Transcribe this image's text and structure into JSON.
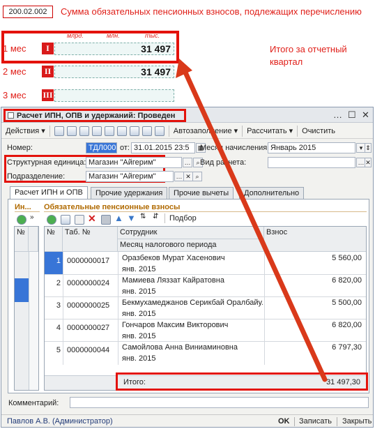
{
  "annotation": {
    "code": "200.02.002",
    "caption": "Сумма обязательных пенсионных взносов, подлежащих перечислению",
    "col_headers": [
      "млрд.",
      "млн.",
      "тыс."
    ],
    "months": [
      {
        "label": "1 мес",
        "roman": "I",
        "amount": "31 497"
      },
      {
        "label": "2 мес",
        "roman": "II",
        "amount": "31 497"
      },
      {
        "label": "3 мес",
        "roman": "III",
        "amount": ""
      }
    ],
    "total_caption": "Итого за отчетный квартал",
    "colors": {
      "accent": "#e3120b",
      "roman_bg": "#d91a1a"
    }
  },
  "window": {
    "title": "Расчет ИПН, ОПВ и удержаний: Проведен",
    "controls": [
      "…",
      "☐",
      "✕"
    ]
  },
  "toolbar": {
    "actions": "Действия",
    "autofill": "Автозаполнение",
    "calculate": "Рассчитать",
    "clear": "Очистить"
  },
  "form": {
    "number_label": "Номер:",
    "number_value": "ТДЛ000",
    "from_label": "от:",
    "date_value": "31.01.2015 23:5",
    "month_label": "Месяц начисления:",
    "month_value": "Январь 2015",
    "unit_label": "Структурная единица:",
    "unit_value": "Магазин \"Айгерим\"",
    "calc_type_label": "Вид расчета:",
    "calc_type_value": "",
    "dept_label": "Подразделение:",
    "dept_value": "Магазин \"Айгерим\""
  },
  "tabs": [
    {
      "label": "Расчет ИПН и ОПВ",
      "active": true
    },
    {
      "label": "Прочие удержания",
      "active": false
    },
    {
      "label": "Прочие вычеты",
      "active": false
    },
    {
      "label": "Дополнительно",
      "active": false
    }
  ],
  "left_section": {
    "title": "Ин..."
  },
  "section": {
    "title": "Обязательные пенсионные взносы",
    "select_button": "Подбор"
  },
  "left_grid": {
    "header": "№"
  },
  "table": {
    "headers": {
      "num": "№",
      "tab": "Таб. №",
      "employee": "Сотрудник",
      "period": "Месяц налогового периода",
      "contribution": "Взнос"
    },
    "rows": [
      {
        "num": "1",
        "tab": "0000000017",
        "employee": "Оразбеков Мурат Хасенович",
        "period": "янв. 2015",
        "contribution": "5 560,00"
      },
      {
        "num": "2",
        "tab": "0000000024",
        "employee": "Мамиева Ляззат Кайратовна",
        "period": "янв. 2015",
        "contribution": "6 820,00"
      },
      {
        "num": "3",
        "tab": "0000000025",
        "employee": "Бекмухамеджанов Серикбай Оралбайулы",
        "period": "янв. 2015",
        "contribution": "5 500,00"
      },
      {
        "num": "4",
        "tab": "0000000027",
        "employee": "Гончаров Максим Викторович",
        "period": "янв. 2015",
        "contribution": "6 820,00"
      },
      {
        "num": "5",
        "tab": "0000000044",
        "employee": "Самойлова Анна Виниаминовна",
        "period": "янв. 2015",
        "contribution": "6 797,30"
      }
    ],
    "total_label": "Итого:",
    "total_value": "31 497,30"
  },
  "comment_label": "Комментарий:",
  "status": {
    "user": "Павлов А.В. (Администратор)",
    "ok": "OK",
    "save": "Записать",
    "close": "Закрыть"
  }
}
